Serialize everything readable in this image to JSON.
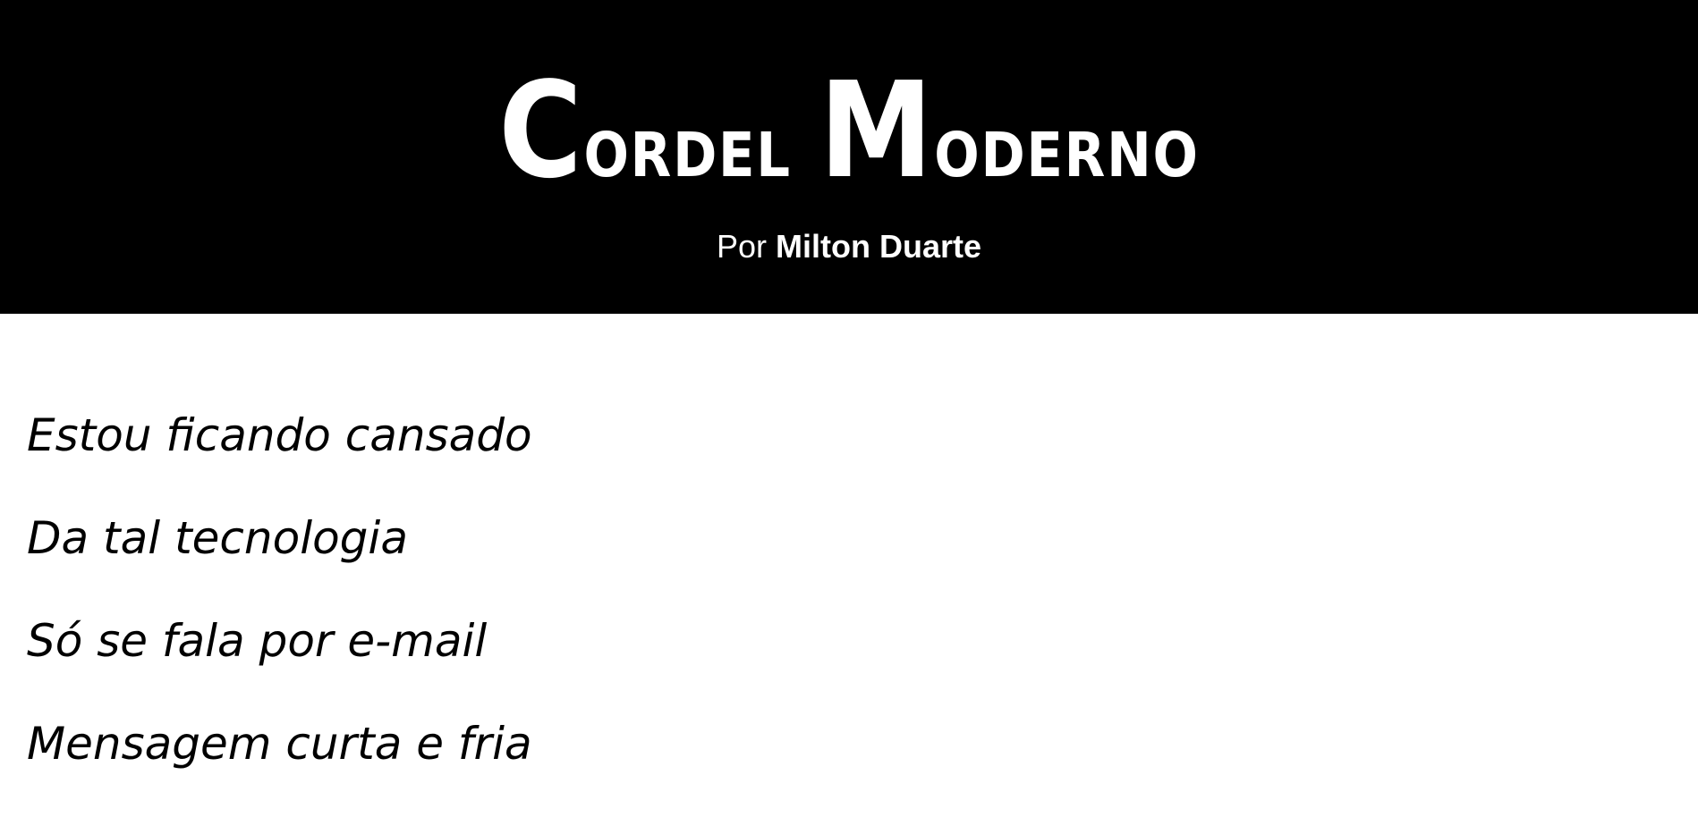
{
  "header": {
    "title_first_cap": "C",
    "title_first_rest": "ordel",
    "title_second_cap": "M",
    "title_second_rest": "oderno",
    "byline_prefix": "Por",
    "byline_author": "Milton Duarte"
  },
  "poem": {
    "verses": [
      "Estou ficando cansado",
      "Da tal tecnologia",
      "Só se fala por e-mail",
      "Mensagem curta e fria"
    ]
  },
  "colors": {
    "header_background": "#000000",
    "header_text": "#ffffff",
    "page_background": "#ffffff",
    "body_text": "#000000"
  }
}
